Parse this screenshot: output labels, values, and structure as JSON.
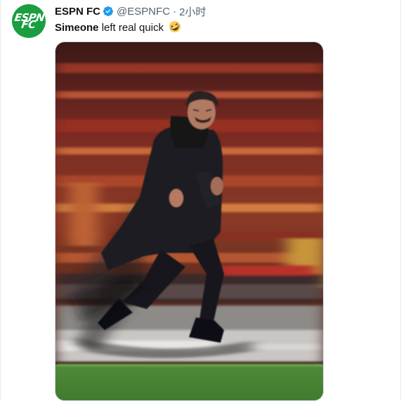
{
  "tweet": {
    "author_name": "ESPN FC",
    "author_handle": "@ESPNFC",
    "separator": "·",
    "timestamp": "2小时",
    "text_bold": "Simeone",
    "text_rest": " left real quick",
    "emoji": "rolling-on-floor-laughing-emoji",
    "avatar_line1": "ESPN",
    "avatar_line2": "FC",
    "avatar_color": "#1a9e3f",
    "verified_color": "#1d9bf0"
  }
}
